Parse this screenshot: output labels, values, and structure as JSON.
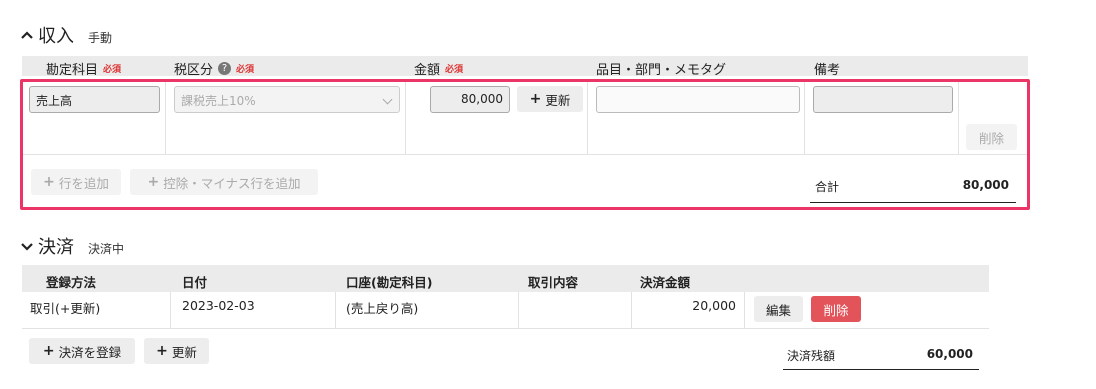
{
  "income": {
    "title": "収入",
    "subtitle": "手動",
    "columns": {
      "account": "勘定科目",
      "tax": "税区分",
      "amount": "金額",
      "items": "品目・部門・メモタグ",
      "note": "備考",
      "required": "必須",
      "help": "?"
    },
    "row": {
      "account": "売上高",
      "tax": "課税売上10%",
      "amount": "80,000",
      "update_button": "更新",
      "items": "",
      "note": "",
      "delete_button": "削除"
    },
    "add_row_button": "行を追加",
    "add_deduction_button": "控除・マイナス行を追加",
    "total_label": "合計",
    "total_value": "80,000"
  },
  "settlement": {
    "title": "決済",
    "subtitle": "決済中",
    "columns": [
      "登録方法",
      "日付",
      "口座(勘定科目)",
      "取引内容",
      "決済金額"
    ],
    "row": {
      "method": "取引(+更新)",
      "date": "2023-02-03",
      "account": "(売上戻り高)",
      "content": "",
      "amount": "20,000",
      "edit_button": "編集",
      "delete_button": "削除"
    },
    "register_button": "決済を登録",
    "update_button": "更新",
    "balance_label": "決済残額",
    "balance_value": "60,000"
  },
  "colors": {
    "highlight": "#ea3566",
    "danger": "#e2545a",
    "required": "#dd3333"
  }
}
